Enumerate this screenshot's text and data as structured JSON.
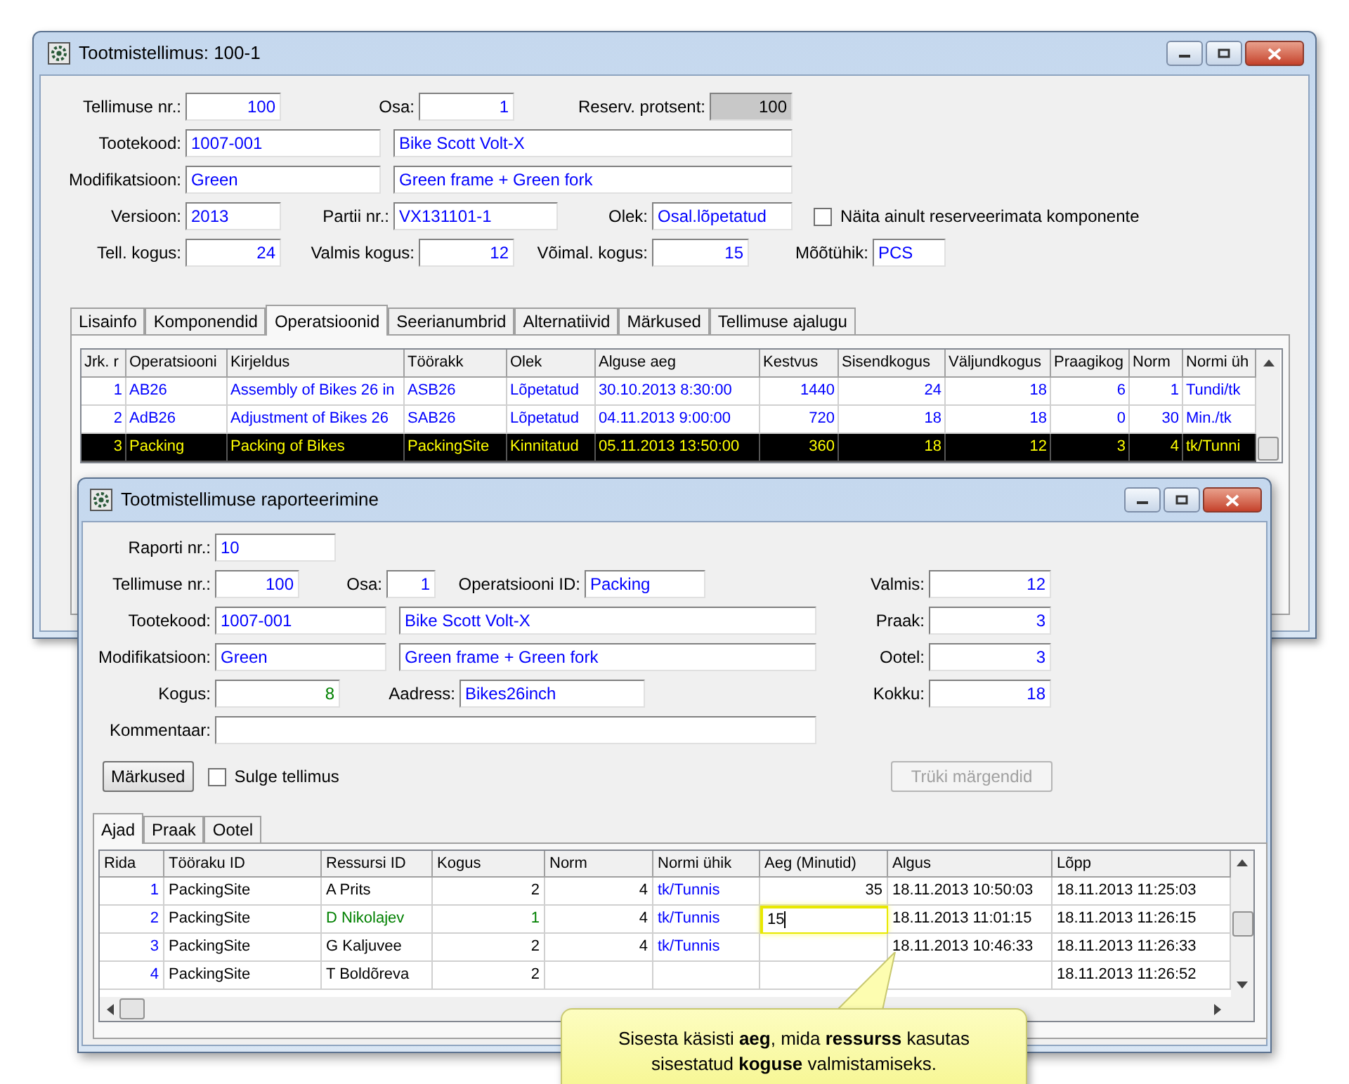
{
  "main_window": {
    "title": "Tootmistellimus: 100-1",
    "form_rows": [
      [
        {
          "kind": "label",
          "text": "Tellimuse nr.:"
        },
        {
          "kind": "number-field",
          "value": "100"
        },
        {
          "kind": "label",
          "text": "Osa:"
        },
        {
          "kind": "number-field",
          "value": "1"
        },
        {
          "kind": "label",
          "text": "Reserv. protsent:"
        },
        {
          "kind": "readonly-field",
          "value": "100"
        }
      ],
      [
        {
          "kind": "label",
          "text": "Tootekood:"
        },
        {
          "kind": "text-field",
          "value": "1007-001"
        },
        {
          "kind": "text-field",
          "value": "Bike Scott Volt-X"
        }
      ],
      [
        {
          "kind": "label",
          "text": "Modifikatsioon:"
        },
        {
          "kind": "text-field",
          "value": "Green"
        },
        {
          "kind": "text-field",
          "value": "Green frame + Green fork"
        }
      ],
      [
        {
          "kind": "label",
          "text": "Versioon:"
        },
        {
          "kind": "text-field",
          "value": "2013"
        },
        {
          "kind": "label",
          "text": "Partii nr.:"
        },
        {
          "kind": "text-field",
          "value": "VX131101-1"
        },
        {
          "kind": "label",
          "text": "Olek:"
        },
        {
          "kind": "text-field",
          "value": "Osal.lõpetatud"
        },
        {
          "kind": "checkbox",
          "text": "Näita ainult reserveerimata komponente",
          "checked": false
        }
      ],
      [
        {
          "kind": "label",
          "text": "Tell. kogus:"
        },
        {
          "kind": "number-field",
          "value": "24"
        },
        {
          "kind": "label",
          "text": "Valmis kogus:"
        },
        {
          "kind": "number-field",
          "value": "12"
        },
        {
          "kind": "label",
          "text": "Võimal. kogus:"
        },
        {
          "kind": "number-field",
          "value": "15"
        },
        {
          "kind": "label",
          "text": "Mõõtühik:"
        },
        {
          "kind": "text-field",
          "value": "PCS"
        }
      ]
    ],
    "tabs": [
      {
        "label": "Lisainfo",
        "selected": false
      },
      {
        "label": "Komponendid",
        "selected": false
      },
      {
        "label": "Operatsioonid",
        "selected": true
      },
      {
        "label": "Seerianumbrid",
        "selected": false
      },
      {
        "label": "Alternatiivid",
        "selected": false
      },
      {
        "label": "Märkused",
        "selected": false
      },
      {
        "label": "Tellimuse ajalugu",
        "selected": false
      }
    ],
    "table": {
      "columns": [
        "Jrk. r",
        "Operatsiooni",
        "Kirjeldus",
        "Töörakk",
        "Olek",
        "Alguse aeg",
        "Kestvus",
        "Sisendkogus",
        "Väljundkogus",
        "Praagikog",
        "Norm",
        "Normi üh"
      ],
      "rows": [
        {
          "selected": false,
          "cells": [
            "1",
            "AB26",
            "Assembly of Bikes 26 in",
            "ASB26",
            "Lõpetatud",
            "30.10.2013 8:30:00",
            "1440",
            "24",
            "18",
            "6",
            "1",
            "Tundi/tk"
          ]
        },
        {
          "selected": false,
          "cells": [
            "2",
            "AdB26",
            "Adjustment of Bikes 26",
            "SAB26",
            "Lõpetatud",
            "04.11.2013 9:00:00",
            "720",
            "18",
            "18",
            "0",
            "30",
            "Min./tk"
          ]
        },
        {
          "selected": true,
          "cells": [
            "3",
            "Packing",
            "Packing of Bikes",
            "PackingSite",
            "Kinnitatud",
            "05.11.2013 13:50:00",
            "360",
            "18",
            "12",
            "3",
            "4",
            "tk/Tunni"
          ]
        }
      ]
    }
  },
  "report_window": {
    "title": "Tootmistellimuse raporteerimine",
    "form_rows": [
      [
        {
          "kind": "label",
          "text": "Raporti nr.:"
        },
        {
          "kind": "text-field",
          "value": "10"
        }
      ],
      [
        {
          "kind": "label",
          "text": "Tellimuse nr.:"
        },
        {
          "kind": "number-field",
          "value": "100"
        },
        {
          "kind": "label",
          "text": "Osa:"
        },
        {
          "kind": "number-field",
          "value": "1"
        },
        {
          "kind": "label",
          "text": "Operatsiooni ID:"
        },
        {
          "kind": "text-field",
          "value": "Packing"
        },
        {
          "kind": "label",
          "text": "Valmis:"
        },
        {
          "kind": "number-field",
          "value": "12"
        }
      ],
      [
        {
          "kind": "label",
          "text": "Tootekood:"
        },
        {
          "kind": "text-field",
          "value": "1007-001"
        },
        {
          "kind": "text-field",
          "value": "Bike Scott Volt-X"
        },
        {
          "kind": "label",
          "text": "Praak:"
        },
        {
          "kind": "number-field",
          "value": "3"
        }
      ],
      [
        {
          "kind": "label",
          "text": "Modifikatsioon:"
        },
        {
          "kind": "text-field",
          "value": "Green"
        },
        {
          "kind": "text-field",
          "value": "Green frame + Green fork"
        },
        {
          "kind": "label",
          "text": "Ootel:"
        },
        {
          "kind": "number-field",
          "value": "3"
        }
      ],
      [
        {
          "kind": "label",
          "text": "Kogus:"
        },
        {
          "kind": "number-field",
          "value": "8",
          "color": "#008000"
        },
        {
          "kind": "label",
          "text": "Aadress:"
        },
        {
          "kind": "text-field",
          "value": "Bikes26inch"
        },
        {
          "kind": "label",
          "text": "Kokku:"
        },
        {
          "kind": "number-field",
          "value": "18"
        }
      ],
      [
        {
          "kind": "label",
          "text": "Kommentaar:"
        },
        {
          "kind": "text-field"
        }
      ]
    ],
    "notes_button": "Märkused",
    "close_order": {
      "text": "Sulge tellimus",
      "checked": false
    },
    "print_button": {
      "label": "Trüki märgendid",
      "disabled": true
    },
    "tabs": [
      {
        "label": "Ajad",
        "selected": true
      },
      {
        "label": "Praak",
        "selected": false
      },
      {
        "label": "Ootel",
        "selected": false
      }
    ],
    "table": {
      "columns": [
        "Rida",
        "Tööraku ID",
        "Ressursi ID",
        "Kogus",
        "Norm",
        "Normi ühik",
        "Aeg (Minutid)",
        "Algus",
        "Lõpp"
      ],
      "rows": [
        {
          "editing": false,
          "cells": [
            "1",
            "PackingSite",
            "A Prits",
            "2",
            "4",
            "tk/Tunnis",
            "35",
            "18.11.2013 10:50:03",
            "18.11.2013 11:25:03"
          ]
        },
        {
          "editing": true,
          "color": "#008000",
          "cells": [
            "2",
            "PackingSite",
            "D Nikolajev",
            "1",
            "4",
            "tk/Tunnis",
            "15",
            "18.11.2013 11:01:15",
            "18.11.2013 11:26:15"
          ]
        },
        {
          "editing": false,
          "cells": [
            "3",
            "PackingSite",
            "G Kaljuvee",
            "2",
            "4",
            "tk/Tunnis",
            null,
            "18.11.2013 10:46:33",
            "18.11.2013 11:26:33"
          ]
        },
        {
          "editing": false,
          "cells": [
            "4",
            "PackingSite",
            "T Boldõreva",
            "2",
            null,
            null,
            null,
            null,
            "18.11.2013 11:26:52"
          ]
        }
      ]
    },
    "callout": "Sisesta käsisti **aeg**, mida **ressurss** kasutas sisestatud **koguse** valmistamiseks."
  }
}
